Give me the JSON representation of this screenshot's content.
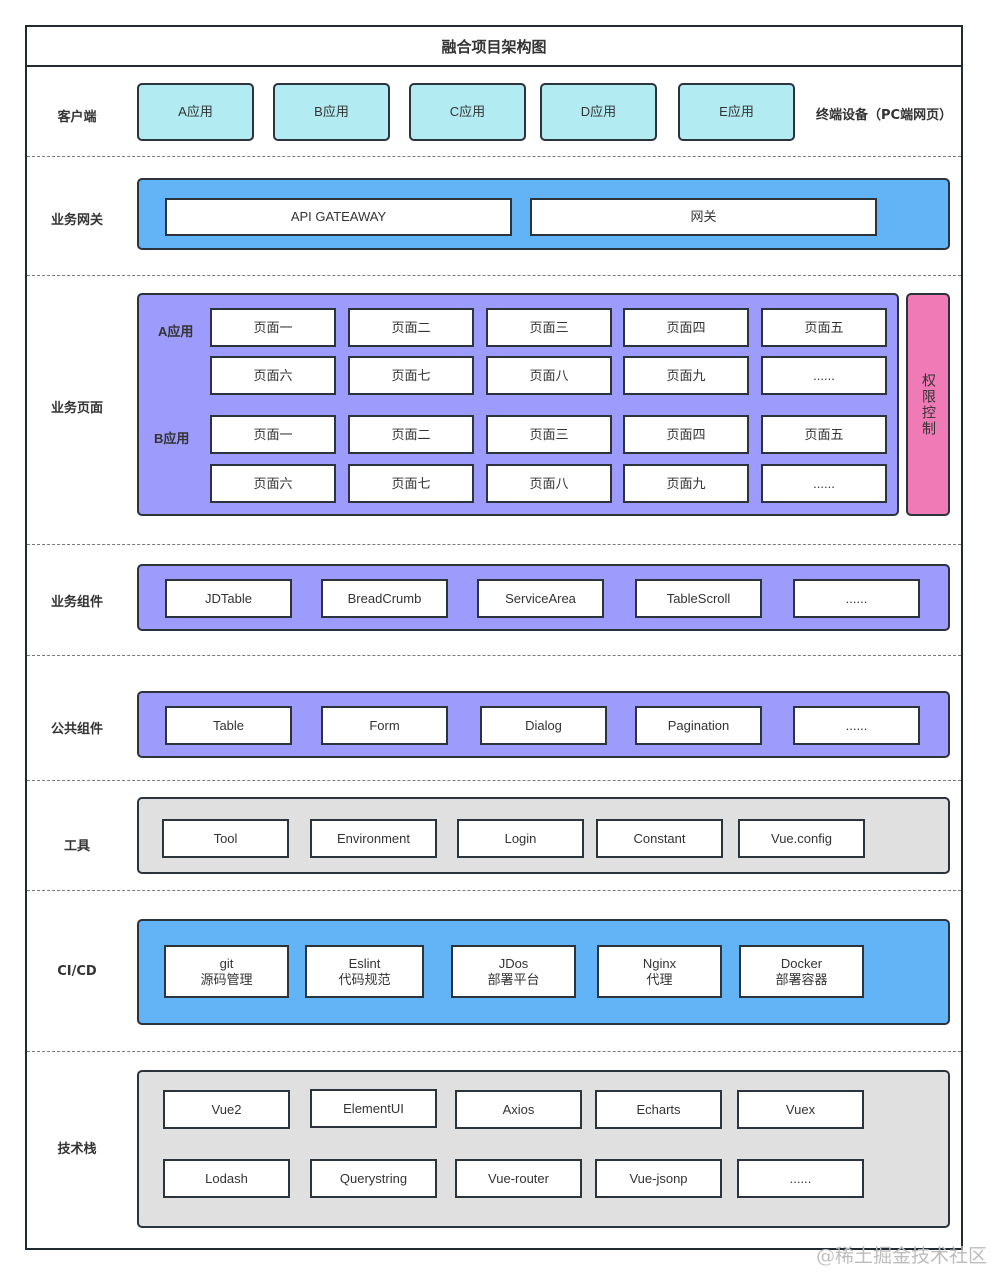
{
  "title": "融合项目架构图",
  "watermark": "@稀土掘金技术社区",
  "layers": {
    "client": {
      "label": "客户端",
      "apps": [
        "A应用",
        "B应用",
        "C应用",
        "D应用",
        "E应用"
      ],
      "note": "终端设备（PC端网页）"
    },
    "gateway": {
      "label": "业务网关",
      "items": [
        "API GATEAWAY",
        "网关"
      ]
    },
    "pages": {
      "label": "业务页面",
      "groups": [
        {
          "name": "A应用",
          "rows": [
            [
              "页面一",
              "页面二",
              "页面三",
              "页面四",
              "页面五"
            ],
            [
              "页面六",
              "页面七",
              "页面八",
              "页面九",
              "......"
            ]
          ]
        },
        {
          "name": "B应用",
          "rows": [
            [
              "页面一",
              "页面二",
              "页面三",
              "页面四",
              "页面五"
            ],
            [
              "页面六",
              "页面七",
              "页面八",
              "页面九",
              "......"
            ]
          ]
        }
      ],
      "permission": "权限控制"
    },
    "biz_components": {
      "label": "业务组件",
      "items": [
        "JDTable",
        "BreadCrumb",
        "ServiceArea",
        "TableScroll",
        "......"
      ]
    },
    "common_components": {
      "label": "公共组件",
      "items": [
        "Table",
        "Form",
        "Dialog",
        "Pagination",
        "......"
      ]
    },
    "tools": {
      "label": "工具",
      "items": [
        "Tool",
        "Environment",
        "Login",
        "Constant",
        "Vue.config"
      ]
    },
    "cicd": {
      "label": "CI/CD",
      "items": [
        {
          "name": "git",
          "desc": "源码管理"
        },
        {
          "name": "Eslint",
          "desc": "代码规范"
        },
        {
          "name": "JDos",
          "desc": "部署平台"
        },
        {
          "name": "Nginx",
          "desc": "代理"
        },
        {
          "name": "Docker",
          "desc": "部署容器"
        }
      ]
    },
    "stack": {
      "label": "技术栈",
      "rows": [
        [
          "Vue2",
          "ElementUI",
          "Axios",
          "Echarts",
          "Vuex"
        ],
        [
          "Lodash",
          "Querystring",
          "Vue-router",
          "Vue-jsonp",
          "......"
        ]
      ]
    }
  },
  "colors": {
    "client_box": "#b3ebf3",
    "gateway_panel": "#63b4f6",
    "pages_panel": "#9d9cfc",
    "permission_panel": "#ef7ab6",
    "tools_panel": "#e0e0e0"
  }
}
